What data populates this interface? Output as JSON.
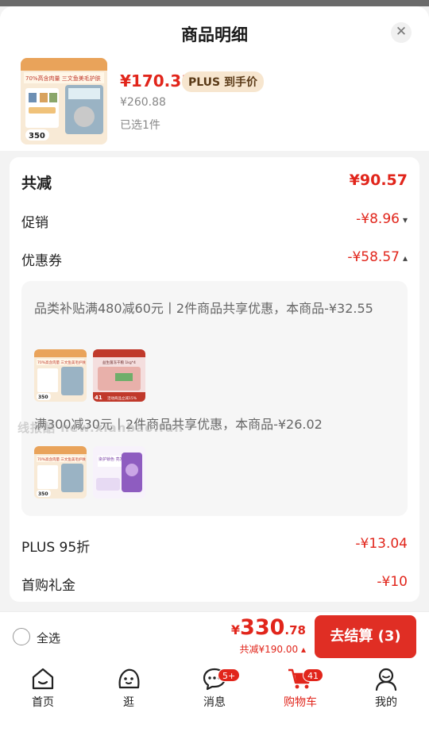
{
  "sheet": {
    "title": "商品明细",
    "close_icon": "close-icon"
  },
  "product": {
    "price": "¥170.31",
    "plus_tag": "PLUS 到手价",
    "original_price": "¥260.88",
    "selected": "已选1件",
    "thumb_text": "70%高含肉量 三文鱼美毛护肤",
    "thumb_weight": "350"
  },
  "discounts": {
    "total_label": "共减",
    "total_value": "¥90.57",
    "promo_label": "促销",
    "promo_value": "-¥8.96",
    "coupon_label": "优惠券",
    "coupon_value": "-¥58.57",
    "coupons": [
      {
        "text": "品类补贴满480减60元丨2件商品共享优惠，本商品-¥32.55"
      },
      {
        "text": "满300减30元丨2件商品共享优惠，本商品-¥26.02"
      }
    ],
    "mini_products": {
      "a_text": "70%高含肉量 三文鱼美毛护肤",
      "a_weight": "350",
      "b_text": "益生菌冻干粮 1kg*4",
      "b_price": "41",
      "b_promo": "活动商品立减15%",
      "d_text": "染护锁色 亮发无忧"
    },
    "plus_label": "PLUS 95折",
    "plus_value": "-¥13.04",
    "gift_label": "首购礼金",
    "gift_value": "-¥10"
  },
  "watermark": "线报酷 new.xianbao.fun",
  "footer": {
    "select_all": "全选",
    "yen": "¥",
    "total_int": "330",
    "total_dec": ".78",
    "discount_text": "共减¥190.00",
    "checkout_label": "去结算 (3)"
  },
  "tabs": [
    {
      "label": "首页",
      "icon": "home-icon"
    },
    {
      "label": "逛",
      "icon": "explore-face-icon"
    },
    {
      "label": "消息",
      "icon": "message-icon",
      "badge": "5+"
    },
    {
      "label": "购物车",
      "icon": "cart-icon",
      "badge": "41"
    },
    {
      "label": "我的",
      "icon": "profile-icon"
    }
  ],
  "colors": {
    "accent": "#e1251b",
    "checkout": "#e02e24",
    "plus_tag_bg": "#f7e6cf"
  }
}
